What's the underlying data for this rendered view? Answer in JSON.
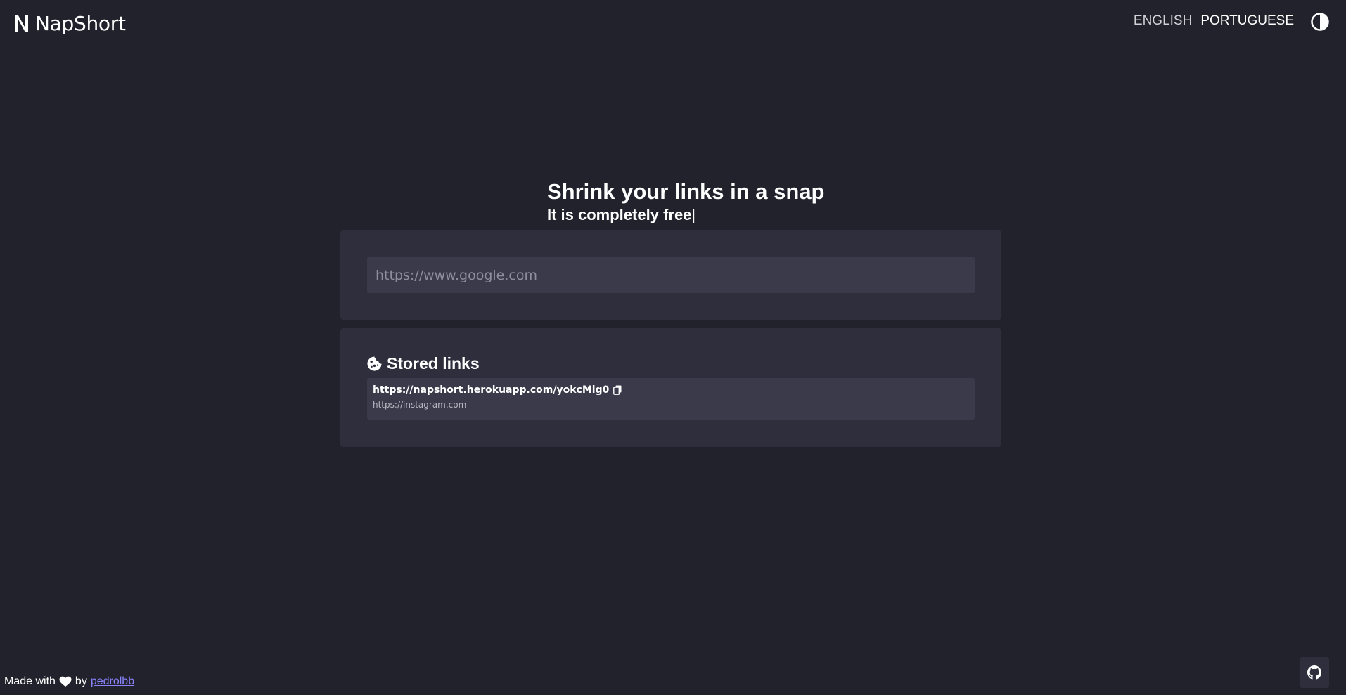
{
  "header": {
    "logo_text": "NapShort",
    "languages": [
      {
        "label": "ENGLISH",
        "active": true
      },
      {
        "label": "PORTUGUESE",
        "active": false
      }
    ],
    "theme_toggle_icon": "contrast-icon"
  },
  "hero": {
    "title": "Shrink your links in a snap",
    "subtitle": "It is completely free",
    "caret": "|"
  },
  "url_form": {
    "placeholder": "https://www.google.com",
    "value": ""
  },
  "stored_links": {
    "heading": "Stored links",
    "icon": "cookie-icon",
    "items": [
      {
        "short_url": "https://napshort.herokuapp.com/yokcMlg0",
        "original_url": "https://instagram.com"
      }
    ]
  },
  "footer": {
    "made_with": "Made with",
    "by": "by",
    "author": "pedrolbb",
    "heart_icon": "heart-icon",
    "github_icon": "github-icon"
  },
  "colors": {
    "background": "#22222c",
    "card": "#2e2e3c",
    "input": "#3a3a4a",
    "link": "#8a83ff"
  }
}
